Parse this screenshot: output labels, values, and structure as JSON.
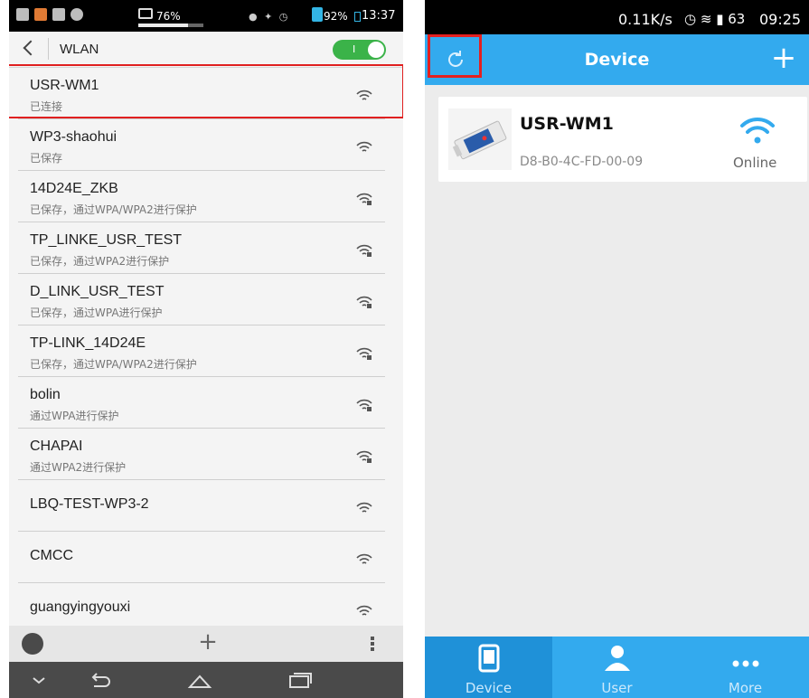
{
  "left_phone": {
    "status_bar": {
      "usb_percent": "76%",
      "usb_progress": 0.76,
      "battery_percent": "92%",
      "time": "13:37"
    },
    "action_bar": {
      "title": "WLAN",
      "toggle_label": "I",
      "toggle_state": "on"
    },
    "networks": [
      {
        "ssid": "USR-WM1",
        "status": "已连接",
        "secured": false
      },
      {
        "ssid": "WP3-shaohui",
        "status": "已保存",
        "secured": false
      },
      {
        "ssid": "14D24E_ZKB",
        "status": "已保存，通过WPA/WPA2进行保护",
        "secured": true
      },
      {
        "ssid": "TP_LINKE_USR_TEST",
        "status": "已保存，通过WPA2进行保护",
        "secured": true
      },
      {
        "ssid": "D_LINK_USR_TEST",
        "status": "已保存，通过WPA进行保护",
        "secured": true
      },
      {
        "ssid": "TP-LINK_14D24E",
        "status": "已保存，通过WPA/WPA2进行保护",
        "secured": true
      },
      {
        "ssid": "bolin",
        "status": "通过WPA进行保护",
        "secured": true
      },
      {
        "ssid": "CHAPAI",
        "status": "通过WPA2进行保护",
        "secured": true
      },
      {
        "ssid": "LBQ-TEST-WP3-2",
        "status": "",
        "secured": false
      },
      {
        "ssid": "CMCC",
        "status": "",
        "secured": false
      },
      {
        "ssid": "guangyingyouxi",
        "status": "",
        "secured": false
      }
    ],
    "bottom_bar": {
      "add_label": "+"
    },
    "colors": {
      "toggle_on": "#3bb349",
      "highlight": "#e02020"
    }
  },
  "right_phone": {
    "status_bar": {
      "speed": "0.11K/s",
      "time": "09:25",
      "battery_level": "63"
    },
    "header": {
      "title": "Device",
      "add_label": "+"
    },
    "device": {
      "name": "USR-WM1",
      "mac": "D8-B0-4C-FD-00-09",
      "status": "Online"
    },
    "tabs": [
      {
        "label": "Device",
        "icon": "tablet-icon",
        "active": true
      },
      {
        "label": "User",
        "icon": "user-icon",
        "active": false
      },
      {
        "label": "More",
        "icon": "more-dots-icon",
        "active": false
      }
    ],
    "colors": {
      "primary": "#33aaee",
      "active_tab": "#1f91d8",
      "highlight": "#e42020"
    }
  }
}
